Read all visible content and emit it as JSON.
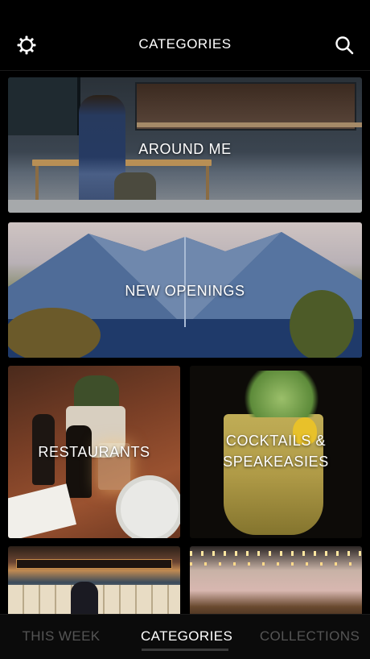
{
  "header": {
    "title": "CATEGORIES",
    "left_icon": "gear-icon",
    "right_icon": "search-icon"
  },
  "categories": [
    {
      "label": "AROUND ME"
    },
    {
      "label": "NEW OPENINGS"
    },
    {
      "label": "RESTAURANTS"
    },
    {
      "label": "COCKTAILS & SPEAKEASIES"
    },
    {
      "label": ""
    },
    {
      "label": ""
    }
  ],
  "tabs": [
    {
      "label": "THIS WEEK",
      "active": false
    },
    {
      "label": "CATEGORIES",
      "active": true
    },
    {
      "label": "COLLECTIONS",
      "active": false
    }
  ],
  "colors": {
    "background": "#000000",
    "active_tab": "#ffffff",
    "inactive_tab": "#555555"
  }
}
